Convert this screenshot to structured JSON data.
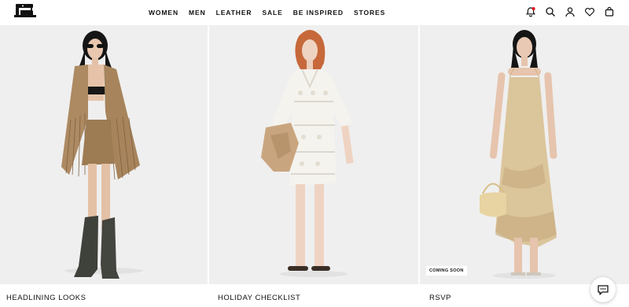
{
  "nav": {
    "items": [
      {
        "label": "WOMEN"
      },
      {
        "label": "MEN"
      },
      {
        "label": "LEATHER"
      },
      {
        "label": "SALE"
      },
      {
        "label": "BE INSPIRED"
      },
      {
        "label": "STORES"
      }
    ]
  },
  "header_icons": [
    "notification-icon",
    "search-icon",
    "account-icon",
    "wishlist-heart-icon",
    "shopping-bag-icon"
  ],
  "cards": [
    {
      "caption": "HEADLINING LOOKS"
    },
    {
      "caption": "HOLIDAY CHECKLIST"
    },
    {
      "caption": "RSVP",
      "badge": "COMING SOON"
    }
  ],
  "colors": {
    "accent_dot": "#e0101a",
    "photo_background": "#efefef",
    "text": "#111111"
  }
}
